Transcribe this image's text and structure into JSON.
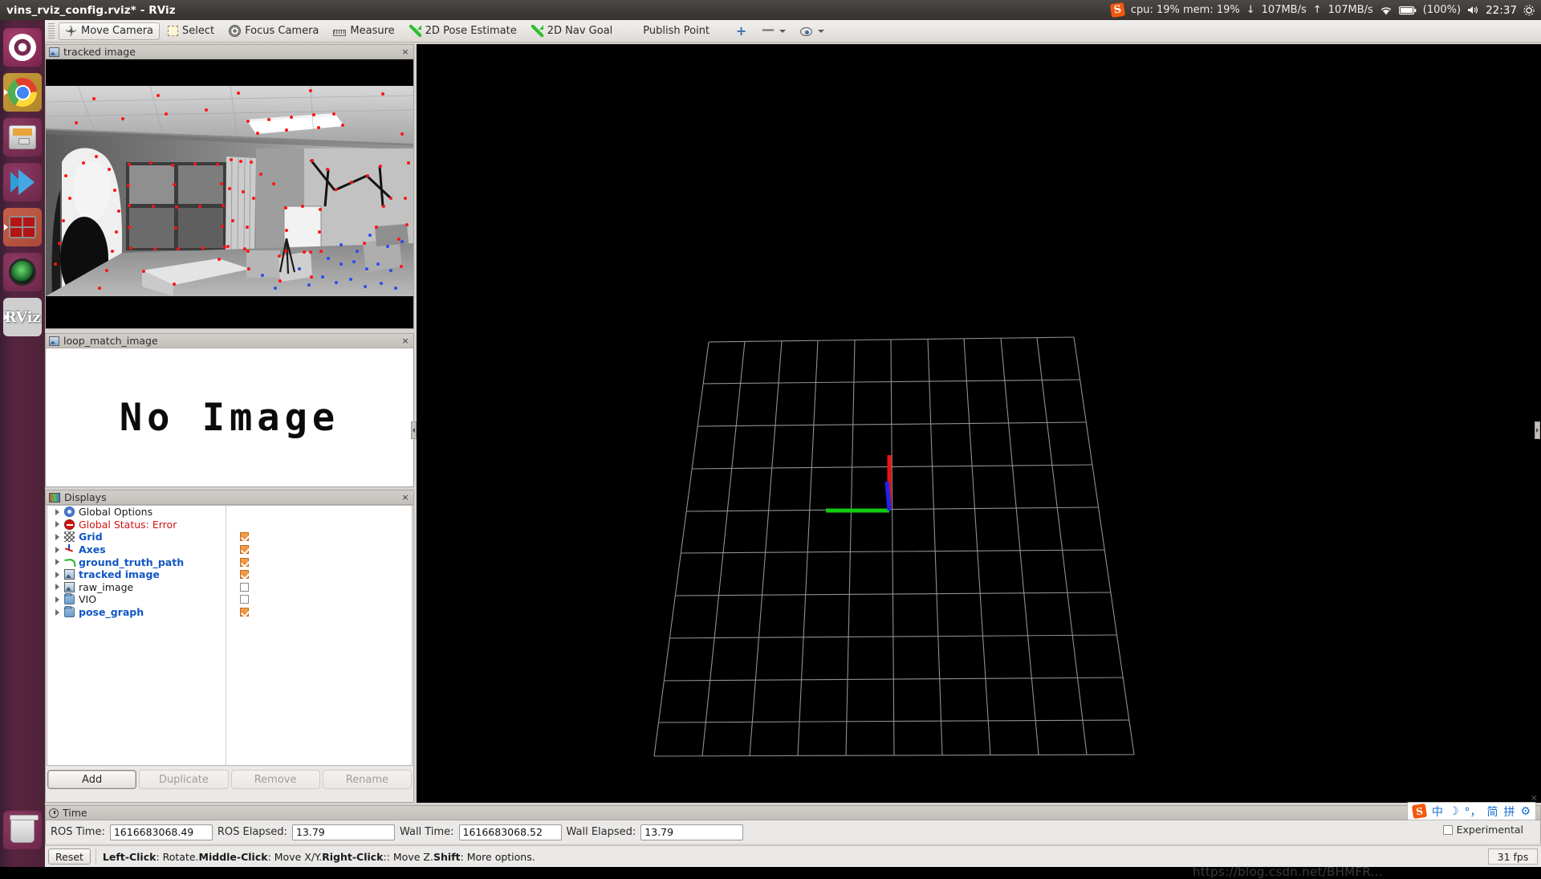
{
  "window": {
    "title": "vins_rviz_config.rviz* - RViz"
  },
  "tray": {
    "sogou_label": "S",
    "stats": "cpu: 19% mem: 19%",
    "down_arrow": "↓",
    "down_rate": "107MB/s",
    "up_arrow": "↑",
    "up_rate": "107MB/s",
    "clock": "22:37",
    "battery": "(100%)",
    "wifi_icon": "wifi-icon",
    "battery_icon": "battery-icon",
    "volume_icon": "volume-icon",
    "settings_icon": "gear-icon"
  },
  "launcher": {
    "items": [
      {
        "name": "ubuntu-dash",
        "icon": "ubuntu-logo-icon"
      },
      {
        "name": "google-chrome",
        "icon": "chrome-icon"
      },
      {
        "name": "files",
        "icon": "file-manager-icon"
      },
      {
        "name": "vscode",
        "icon": "vscode-icon"
      },
      {
        "name": "terminal",
        "icon": "terminal-icon"
      },
      {
        "name": "cheese",
        "icon": "camera-icon"
      },
      {
        "name": "rviz",
        "icon": "rviz-icon",
        "label": "RViz"
      },
      {
        "name": "trash",
        "icon": "trash-icon"
      }
    ]
  },
  "toolbar": {
    "buttons": [
      {
        "label": "Move Camera",
        "icon": "move-camera-icon",
        "active": true
      },
      {
        "label": "Select",
        "icon": "select-icon",
        "active": false
      },
      {
        "label": "Focus Camera",
        "icon": "focus-camera-icon",
        "active": false
      },
      {
        "label": "Measure",
        "icon": "measure-icon",
        "active": false
      },
      {
        "label": "2D Pose Estimate",
        "icon": "pose-estimate-icon",
        "active": false
      },
      {
        "label": "2D Nav Goal",
        "icon": "nav-goal-icon",
        "active": false
      },
      {
        "label": "Publish Point",
        "icon": "publish-point-icon",
        "active": false
      }
    ],
    "extra": [
      {
        "name": "add-tool-button",
        "icon": "plus-icon"
      },
      {
        "name": "remove-tool-button",
        "icon": "minus-icon"
      },
      {
        "name": "visibility-button",
        "icon": "eye-icon"
      }
    ]
  },
  "panels": {
    "tracked_image": {
      "title": "tracked image",
      "icon": "image-panel-icon",
      "close": "×"
    },
    "loop_match_image": {
      "title": "loop_match_image",
      "icon": "image-panel-icon",
      "close": "×",
      "placeholder": "No Image"
    },
    "displays": {
      "title": "Displays",
      "icon": "displays-panel-icon",
      "close": "×"
    },
    "time": {
      "title": "Time",
      "icon": "clock-icon"
    }
  },
  "displays": {
    "tree": [
      {
        "label": "Global Options",
        "icon": "gear-icon",
        "style": "black",
        "checkbox": "none"
      },
      {
        "label": "Global Status: Error",
        "icon": "error-icon",
        "style": "red",
        "checkbox": "none"
      },
      {
        "label": "Grid",
        "icon": "grid-icon",
        "style": "blue",
        "checkbox": "checked"
      },
      {
        "label": "Axes",
        "icon": "axes-icon",
        "style": "blue",
        "checkbox": "checked"
      },
      {
        "label": "ground_truth_path",
        "icon": "path-icon",
        "style": "blue",
        "checkbox": "checked"
      },
      {
        "label": "tracked image",
        "icon": "image-icon",
        "style": "blue",
        "checkbox": "checked"
      },
      {
        "label": "raw_image",
        "icon": "image-icon",
        "style": "black",
        "checkbox": "unchecked"
      },
      {
        "label": "VIO",
        "icon": "folder-icon",
        "style": "black",
        "checkbox": "unchecked"
      },
      {
        "label": "pose_graph",
        "icon": "folder-icon",
        "style": "blue",
        "checkbox": "checked"
      }
    ],
    "buttons": [
      {
        "label": "Add",
        "enabled": true
      },
      {
        "label": "Duplicate",
        "enabled": false
      },
      {
        "label": "Remove",
        "enabled": false
      },
      {
        "label": "Rename",
        "enabled": false
      }
    ]
  },
  "time": {
    "ros_time_label": "ROS Time:",
    "ros_time_value": "1616683068.49",
    "ros_elapsed_label": "ROS Elapsed:",
    "ros_elapsed_value": "13.79",
    "wall_time_label": "Wall Time:",
    "wall_time_value": "1616683068.52",
    "wall_elapsed_label": "Wall Elapsed:",
    "wall_elapsed_value": "13.79"
  },
  "statusbar": {
    "reset_label": "Reset",
    "hint_parts": [
      {
        "text": "Left-Click",
        "bold": true
      },
      {
        "text": ": Rotate.  ",
        "bold": false
      },
      {
        "text": "Middle-Click",
        "bold": true
      },
      {
        "text": ": Move X/Y.  ",
        "bold": false
      },
      {
        "text": "Right-Click",
        "bold": true
      },
      {
        "text": ":: Move Z.  ",
        "bold": false
      },
      {
        "text": "Shift",
        "bold": true
      },
      {
        "text": ": More options.",
        "bold": false
      }
    ],
    "fps": "31 fps",
    "watermark": "https://blog.csdn.net/BHMFR..."
  },
  "ime": {
    "sogou": "S",
    "lang": "中",
    "moon": "☽",
    "punct": "°，",
    "simple": "简",
    "pinyin": "拼",
    "gear": "⚙",
    "close": "✕",
    "experimental_label": "Experimental"
  },
  "viewport": {
    "grid_color": "#9b9b9b",
    "background": "#000000",
    "axes": {
      "x_color": "#22cc22",
      "y_color": "#2222ee",
      "z_color": "#dd2222"
    }
  }
}
